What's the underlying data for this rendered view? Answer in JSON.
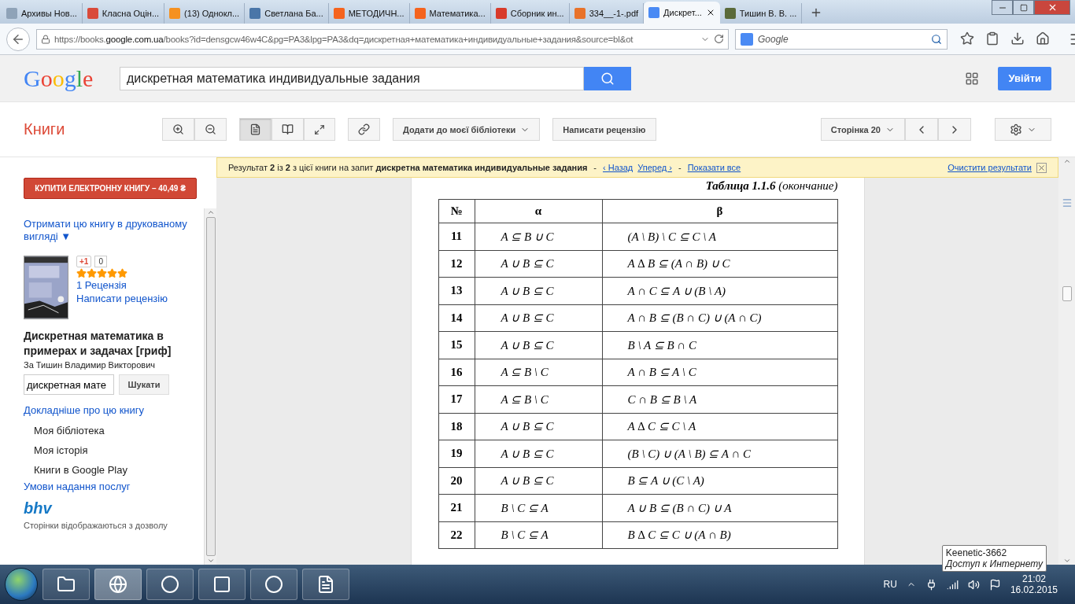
{
  "browser": {
    "tabs": [
      {
        "label": "Архивы Нов...",
        "selected": false,
        "color": "#8fa3b8"
      },
      {
        "label": "Класна Оцін...",
        "selected": false,
        "color": "#d94a3a"
      },
      {
        "label": "(13) Однокл...",
        "selected": false,
        "color": "#f59120"
      },
      {
        "label": "Светлана Ба...",
        "selected": false,
        "color": "#4a76a8"
      },
      {
        "label": "МЕТОДИЧН...",
        "selected": false,
        "color": "#f5631d"
      },
      {
        "label": "Математика...",
        "selected": false,
        "color": "#f5631d"
      },
      {
        "label": "Сборник ин...",
        "selected": false,
        "color": "#d83a2a"
      },
      {
        "label": "334__-1-.pdf",
        "selected": false,
        "color": "#e8722a"
      },
      {
        "label": "Дискрет...",
        "selected": true,
        "color": "#4a8af4"
      },
      {
        "label": "Тишин В. В. ...",
        "selected": false,
        "color": "#5a6a3a"
      }
    ],
    "url": {
      "prefix": "https://books.",
      "host": "google.com.ua",
      "rest": "/books?id=densgcw46w4C&pg=PA3&lpg=PA3&dq=дискретная+математика+индивидуальные+задания&source=bl&ot"
    },
    "search_placeholder": "Google"
  },
  "header": {
    "logo": "Google",
    "query": "дискретная математика индивидуальные задания",
    "sign_in": "Увійти"
  },
  "books_bar": {
    "title": "Книги",
    "add_to_library": "Додати до моєї бібліотеки",
    "write_review": "Написати рецензію",
    "page": "Сторінка 20"
  },
  "sidebar": {
    "buy": "КУПИТИ ЕЛЕКТРОННУ КНИГУ – 40,49 ₴",
    "get_print": "Отримати цю книгу в друкованому вигляді ▼",
    "plus_one": "+1",
    "plus_count": "0",
    "stars": 5,
    "reviews": "1 Рецензія",
    "write_review": "Написати рецензію",
    "book_title": "Дискретная математика в примерах и задачах [гриф]",
    "author": "За Тишин Владимир Викторович",
    "search_value": "дискретная мате",
    "search_button": "Шукати",
    "more": "Докладніше про цю книгу",
    "menu": [
      "Моя бібліотека",
      "Моя історія",
      "Книги в Google Play"
    ],
    "terms": "Умови надання послуг",
    "publisher_logo": "bhv",
    "permission": "Сторінки відображаються з дозволу"
  },
  "notice": {
    "separator": "-",
    "text": "Результат **2** із **2** з цієї книги на запит **дискретна математика индивидуальные задания**",
    "back": "‹ Назад",
    "forward": "Уперед ›",
    "show_all": "Показати все",
    "clear": "Очистити результати"
  },
  "page": {
    "caption": "Таблица 1.1.6",
    "caption_note": "(окончание)",
    "columns": [
      "№",
      "α",
      "β"
    ],
    "rows": [
      [
        "11",
        "A ⊆ B ∪ C",
        "(A \\ B) \\ C ⊆ C \\ A"
      ],
      [
        "12",
        "A ∪ B ⊆ C",
        "A ∆ B ⊆ (A ∩ B) ∪ C"
      ],
      [
        "13",
        "A ∪ B ⊆ C",
        "A ∩ C ⊆ A ∪ (B \\ A)"
      ],
      [
        "14",
        "A ∪ B ⊆ C",
        "A ∩ B ⊆ (B ∩ C) ∪ (A ∩ C)"
      ],
      [
        "15",
        "A ∪ B ⊆ C",
        "B \\ A ⊆ B ∩ C"
      ],
      [
        "16",
        "A ⊆ B \\ C",
        "A ∩ B ⊆ A \\ C"
      ],
      [
        "17",
        "A ⊆ B \\ C",
        "C ∩ B ⊆ B \\ A"
      ],
      [
        "18",
        "A ∪ B ⊆ C",
        "A ∆ C ⊆ C \\ A"
      ],
      [
        "19",
        "A ∪ B ⊆ C",
        "(B \\ C) ∪ (A \\ B) ⊆ A ∩ C"
      ],
      [
        "20",
        "A ∪ B ⊆ C",
        "B ⊆ A ∪ (C \\ A)"
      ],
      [
        "21",
        "B \\ C ⊆ A",
        "A ∪ B ⊆ (B ∩ C) ∪ A"
      ],
      [
        "22",
        "B \\ C ⊆ A",
        "B ∆ C ⊆ C ∪ (A ∩ B)"
      ]
    ]
  },
  "taskbar": {
    "apps": [
      {
        "selected": false
      },
      {
        "selected": true
      },
      {
        "selected": false
      },
      {
        "selected": false
      },
      {
        "selected": false
      },
      {
        "selected": false
      }
    ],
    "language": "RU",
    "time": "21:02",
    "date": "16.02.2015"
  },
  "tooltip": {
    "network": "Keenetic-3662",
    "status": "Доступ к Интернету"
  }
}
